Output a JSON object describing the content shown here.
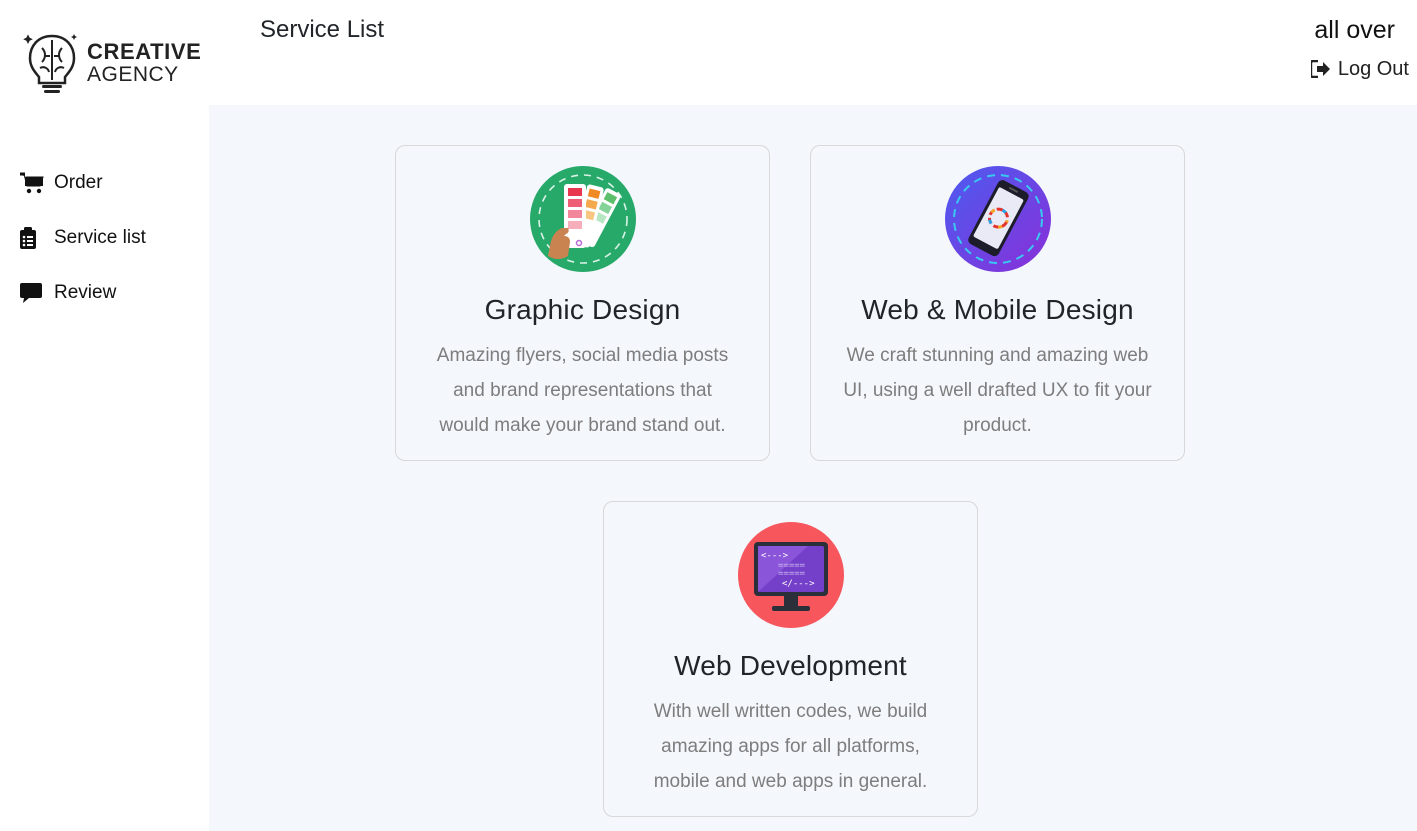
{
  "brand": {
    "line1": "CREATIVE",
    "line2": "AGENCY"
  },
  "sidebar": {
    "items": [
      {
        "label": "Order",
        "icon": "cart-icon"
      },
      {
        "label": "Service list",
        "icon": "clipboard-list-icon"
      },
      {
        "label": "Review",
        "icon": "comment-icon"
      }
    ]
  },
  "header": {
    "title": "Service List",
    "user_name": "all over",
    "logout_label": "Log Out"
  },
  "services": [
    {
      "title": "Graphic Design",
      "description": "Amazing flyers, social media posts and brand representations that would make your brand stand out.",
      "icon": "color-palette-icon",
      "icon_bg": "#27a96a"
    },
    {
      "title": "Web & Mobile Design",
      "description": "We craft stunning and amazing web UI, using a well drafted UX to fit your product.",
      "icon": "smartphone-icon",
      "icon_bg": "#6f3fe0"
    },
    {
      "title": "Web Development",
      "description": "With well written codes, we build amazing apps for all platforms, mobile and web apps in general.",
      "icon": "monitor-code-icon",
      "icon_bg": "#f7565c"
    }
  ],
  "colors": {
    "main_bg": "#f4f7fc",
    "card_border": "#d8d8d8",
    "muted_text": "#7d7d7d"
  }
}
